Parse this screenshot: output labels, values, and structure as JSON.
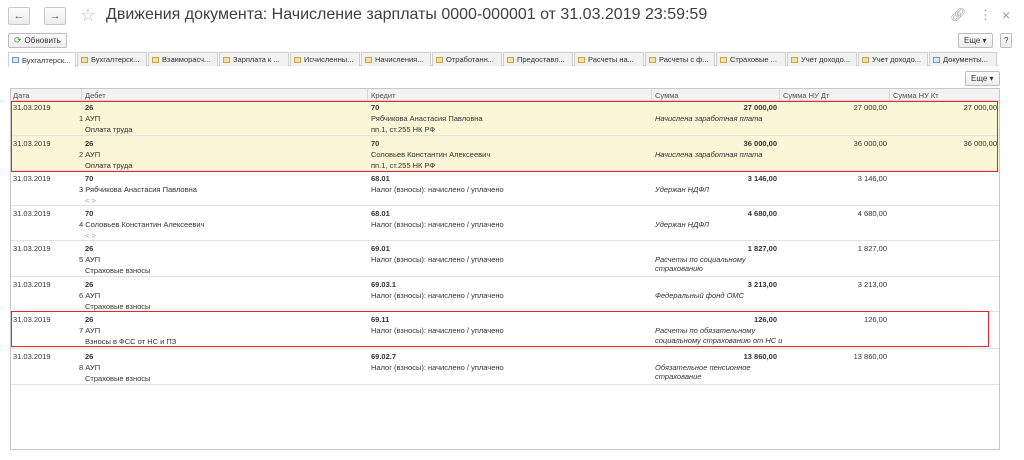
{
  "window": {
    "title": "Движения документа: Начисление зарплаты 0000-000001 от 31.03.2019 23:59:59"
  },
  "toolbar": {
    "refresh_label": "Обновить",
    "more_label": "Еще ▾",
    "grid_more_label": "Еще ▾"
  },
  "tabs": [
    "Бухгалтерск...",
    "Бухгалтерск...",
    "Взаиморасч...",
    "Зарплата к ...",
    "Исчисленны...",
    "Начисления...",
    "Отработанн...",
    "Предоставл...",
    "Расчеты на...",
    "Расчеты с ф...",
    "Страховые ...",
    "Учет доходо...",
    "Учет доходо...",
    "Документы..."
  ],
  "columns": {
    "date": "Дата",
    "debit": "Дебет",
    "credit": "Кредит",
    "sum": "Сумма",
    "sum_nu_dt": "Сумма НУ Дт",
    "sum_nu_kt": "Сумма НУ Кт"
  },
  "rows": [
    {
      "date": "31.03.2019",
      "dt": "26",
      "dt2": "1 АУП",
      "dt3": "Оплата труда",
      "kt": "70",
      "kt2": "Рябчикова Анастасия Павловна",
      "kt3": "пп.1, ст.255 НК РФ",
      "sum": "27 000,00",
      "comment": "Начислена заработная плата",
      "nu_dt": "27 000,00",
      "nu_kt": "27 000,00"
    },
    {
      "date": "31.03.2019",
      "dt": "26",
      "dt2": "2 АУП",
      "dt3": "Оплата труда",
      "kt": "70",
      "kt2": "Соловьев Константин Алексеевич",
      "kt3": "пп.1, ст.255 НК РФ",
      "sum": "36 000,00",
      "comment": "Начислена заработная плата",
      "nu_dt": "36 000,00",
      "nu_kt": "36 000,00"
    },
    {
      "date": "31.03.2019",
      "dt": "70",
      "dt2": "3 Рябчикова Анастасия Павловна",
      "dt3": "< >",
      "kt": "68.01",
      "kt2": "Налог (взносы): начислено / уплачено",
      "kt3": "",
      "sum": "3 146,00",
      "comment": "Удержан НДФЛ",
      "nu_dt": "3 146,00",
      "nu_kt": ""
    },
    {
      "date": "31.03.2019",
      "dt": "70",
      "dt2": "4 Соловьев Константин Алексеевич",
      "dt3": "< >",
      "kt": "68.01",
      "kt2": "Налог (взносы): начислено / уплачено",
      "kt3": "",
      "sum": "4 680,00",
      "comment": "Удержан НДФЛ",
      "nu_dt": "4 680,00",
      "nu_kt": ""
    },
    {
      "date": "31.03.2019",
      "dt": "26",
      "dt2": "5 АУП",
      "dt3": "Страховые взносы",
      "kt": "69.01",
      "kt2": "Налог (взносы): начислено / уплачено",
      "kt3": "",
      "sum": "1 827,00",
      "comment": "Расчеты по социальному",
      "comment2": "страхованию",
      "nu_dt": "1 827,00",
      "nu_kt": ""
    },
    {
      "date": "31.03.2019",
      "dt": "26",
      "dt2": "6 АУП",
      "dt3": "Страховые взносы",
      "kt": "69.03.1",
      "kt2": "Налог (взносы): начислено / уплачено",
      "kt3": "",
      "sum": "3 213,00",
      "comment": "Федеральный фонд ОМС",
      "nu_dt": "3 213,00",
      "nu_kt": ""
    },
    {
      "date": "31.03.2019",
      "dt": "26",
      "dt2": "7 АУП",
      "dt3": "Взносы в ФСС от НС и ПЗ",
      "kt": "69.11",
      "kt2": "Налог (взносы): начислено / уплачено",
      "kt3": "",
      "sum": "126,00",
      "comment": "Расчеты по обязательному",
      "comment2": "социальному страхованию от НС и",
      "nu_dt": "126,00",
      "nu_kt": ""
    },
    {
      "date": "31.03.2019",
      "dt": "26",
      "dt2": "8 АУП",
      "dt3": "Страховые взносы",
      "kt": "69.02.7",
      "kt2": "Налог (взносы): начислено / уплачено",
      "kt3": "",
      "sum": "13 860,00",
      "comment": "Обязательное пенсионное",
      "comment2": "страхование",
      "nu_dt": "13 860,00",
      "nu_kt": ""
    }
  ]
}
